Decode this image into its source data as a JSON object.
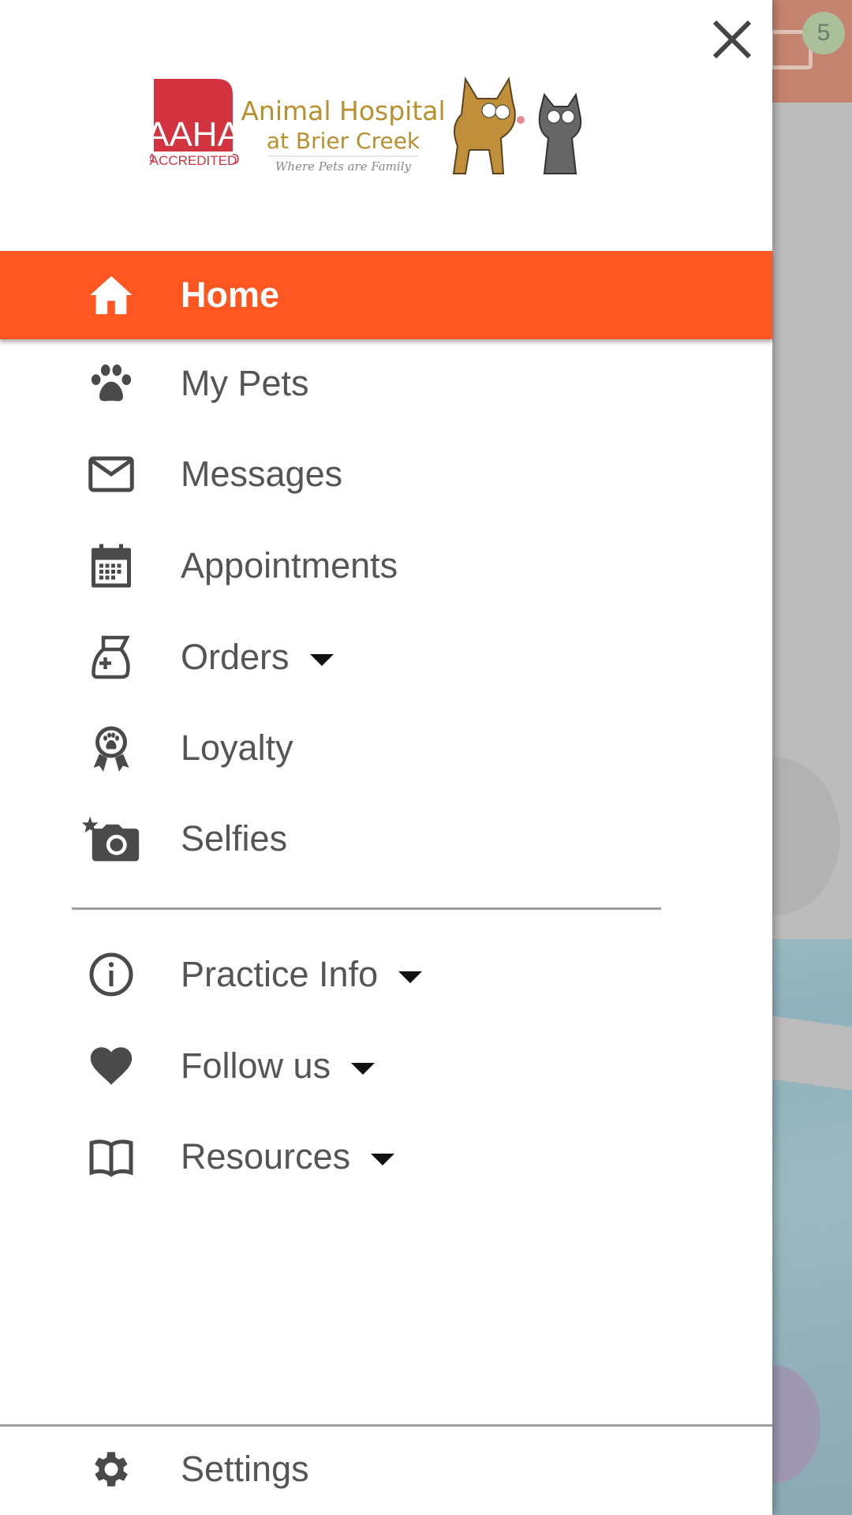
{
  "background": {
    "notification_count": "5"
  },
  "drawer": {
    "logo": {
      "accreditation": "AAHA",
      "accreditation_sub": "ACCREDITED",
      "name_line1": "Animal Hospital",
      "name_line2": "at Brier Creek",
      "tagline": "Where Pets are Family"
    },
    "items": [
      {
        "label": "Home",
        "icon": "home-icon",
        "active": true
      },
      {
        "label": "My Pets",
        "icon": "paw-icon"
      },
      {
        "label": "Messages",
        "icon": "envelope-icon"
      },
      {
        "label": "Appointments",
        "icon": "calendar-icon"
      },
      {
        "label": "Orders",
        "icon": "medicine-bag-icon",
        "expandable": true
      },
      {
        "label": "Loyalty",
        "icon": "award-ribbon-icon"
      },
      {
        "label": "Selfies",
        "icon": "camera-icon"
      }
    ],
    "secondary_items": [
      {
        "label": "Practice Info",
        "icon": "info-icon",
        "expandable": true
      },
      {
        "label": "Follow us",
        "icon": "heart-icon",
        "expandable": true
      },
      {
        "label": "Resources",
        "icon": "book-icon",
        "expandable": true
      }
    ],
    "settings": {
      "label": "Settings",
      "icon": "gear-icon"
    }
  },
  "colors": {
    "active": "#ff5722",
    "text": "#555555",
    "icon": "#4a4a4a",
    "aaha_red": "#d3333f",
    "logo_gold": "#b8902e"
  }
}
